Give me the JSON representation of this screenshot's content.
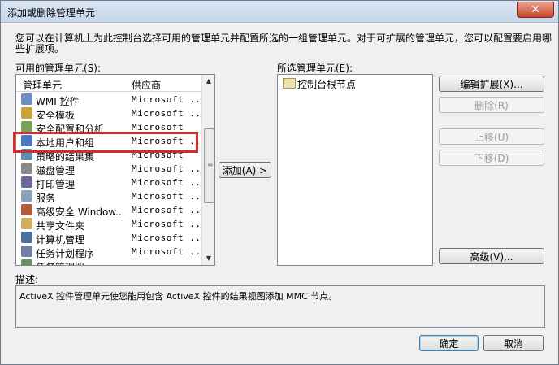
{
  "window": {
    "title": "添加或删除管理单元",
    "close_glyph": "✕"
  },
  "description_top": "您可以在计算机上为此控制台选择可用的管理单元并配置所选的一组管理单元。对于可扩展的管理单元，您可以配置要启用哪些扩展项。",
  "available": {
    "label": "可用的管理单元(S):",
    "columns": [
      "管理单元",
      "供应商"
    ],
    "rows": [
      {
        "name": "WMI 控件",
        "vendor": "Microsoft ...",
        "icon": "wmi-icon"
      },
      {
        "name": "安全模板",
        "vendor": "Microsoft ...",
        "icon": "security-template-icon"
      },
      {
        "name": "安全配置和分析",
        "vendor": "Microsoft",
        "icon": "security-config-icon"
      },
      {
        "name": "本地用户和组",
        "vendor": "Microsoft ...",
        "icon": "users-groups-icon"
      },
      {
        "name": "策略的结果集",
        "vendor": "Microsoft",
        "icon": "policy-icon"
      },
      {
        "name": "磁盘管理",
        "vendor": "Microsoft ...",
        "icon": "disk-icon"
      },
      {
        "name": "打印管理",
        "vendor": "Microsoft ...",
        "icon": "printer-icon"
      },
      {
        "name": "服务",
        "vendor": "Microsoft ...",
        "icon": "services-icon"
      },
      {
        "name": "高级安全 Window...",
        "vendor": "Microsoft ...",
        "icon": "firewall-icon"
      },
      {
        "name": "共享文件夹",
        "vendor": "Microsoft ...",
        "icon": "shared-folder-icon"
      },
      {
        "name": "计算机管理",
        "vendor": "Microsoft ...",
        "icon": "computer-icon"
      },
      {
        "name": "任务计划程序",
        "vendor": "Microsoft ...",
        "icon": "clock-icon"
      },
      {
        "name": "任务管理器",
        "vendor": "",
        "icon": "task-icon"
      }
    ]
  },
  "add_button": "添加(A) >",
  "selected": {
    "label": "所选管理单元(E):",
    "items": [
      "控制台根节点"
    ]
  },
  "side_buttons": {
    "edit_ext": "编辑扩展(X)...",
    "remove": "删除(R)",
    "move_up": "上移(U)",
    "move_down": "下移(D)",
    "advanced": "高级(V)..."
  },
  "description": {
    "label": "描述:",
    "text": "ActiveX 控件管理单元使您能用包含 ActiveX 控件的结果视图添加 MMC 节点。"
  },
  "footer": {
    "ok": "确定",
    "cancel": "取消"
  },
  "colors": {
    "highlight": "#d32b2b",
    "title_gradient_top": "#dbe6f3"
  }
}
